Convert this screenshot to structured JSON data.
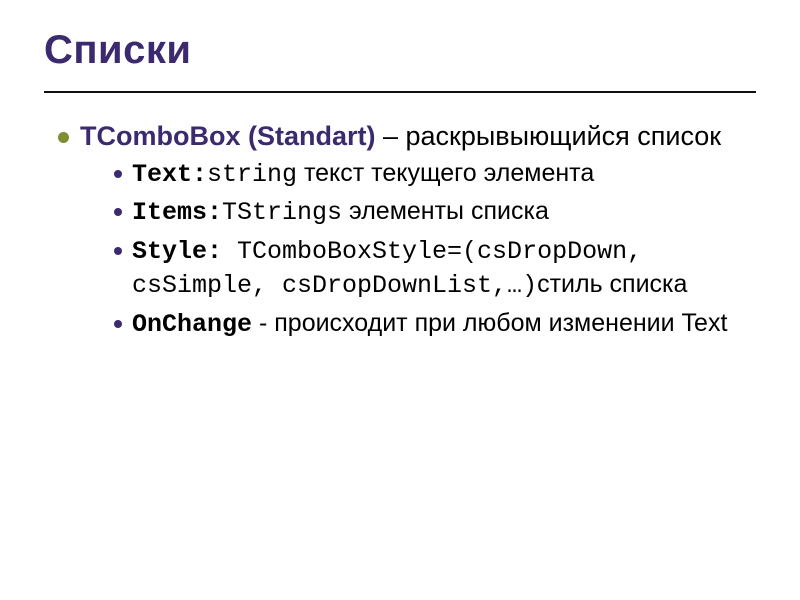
{
  "title": "Списки",
  "main": {
    "term": "TComboBox (Standart)",
    "dash": " – ",
    "desc": "раскрывыющийся список"
  },
  "items": [
    {
      "prop": "Text:",
      "code": "string",
      "tail": " текст текущего элемента"
    },
    {
      "prop": "Items:",
      "code": "TStrings",
      "tail": " элементы списка"
    },
    {
      "prop": "Style:",
      "code": " TComboBoxStyle=(csDropDown, csSimple, csDropDownList,…)",
      "tail": "стиль списка"
    },
    {
      "prop": "OnChange",
      "code": "",
      "tail": " - происходит при любом изменении Text"
    }
  ]
}
